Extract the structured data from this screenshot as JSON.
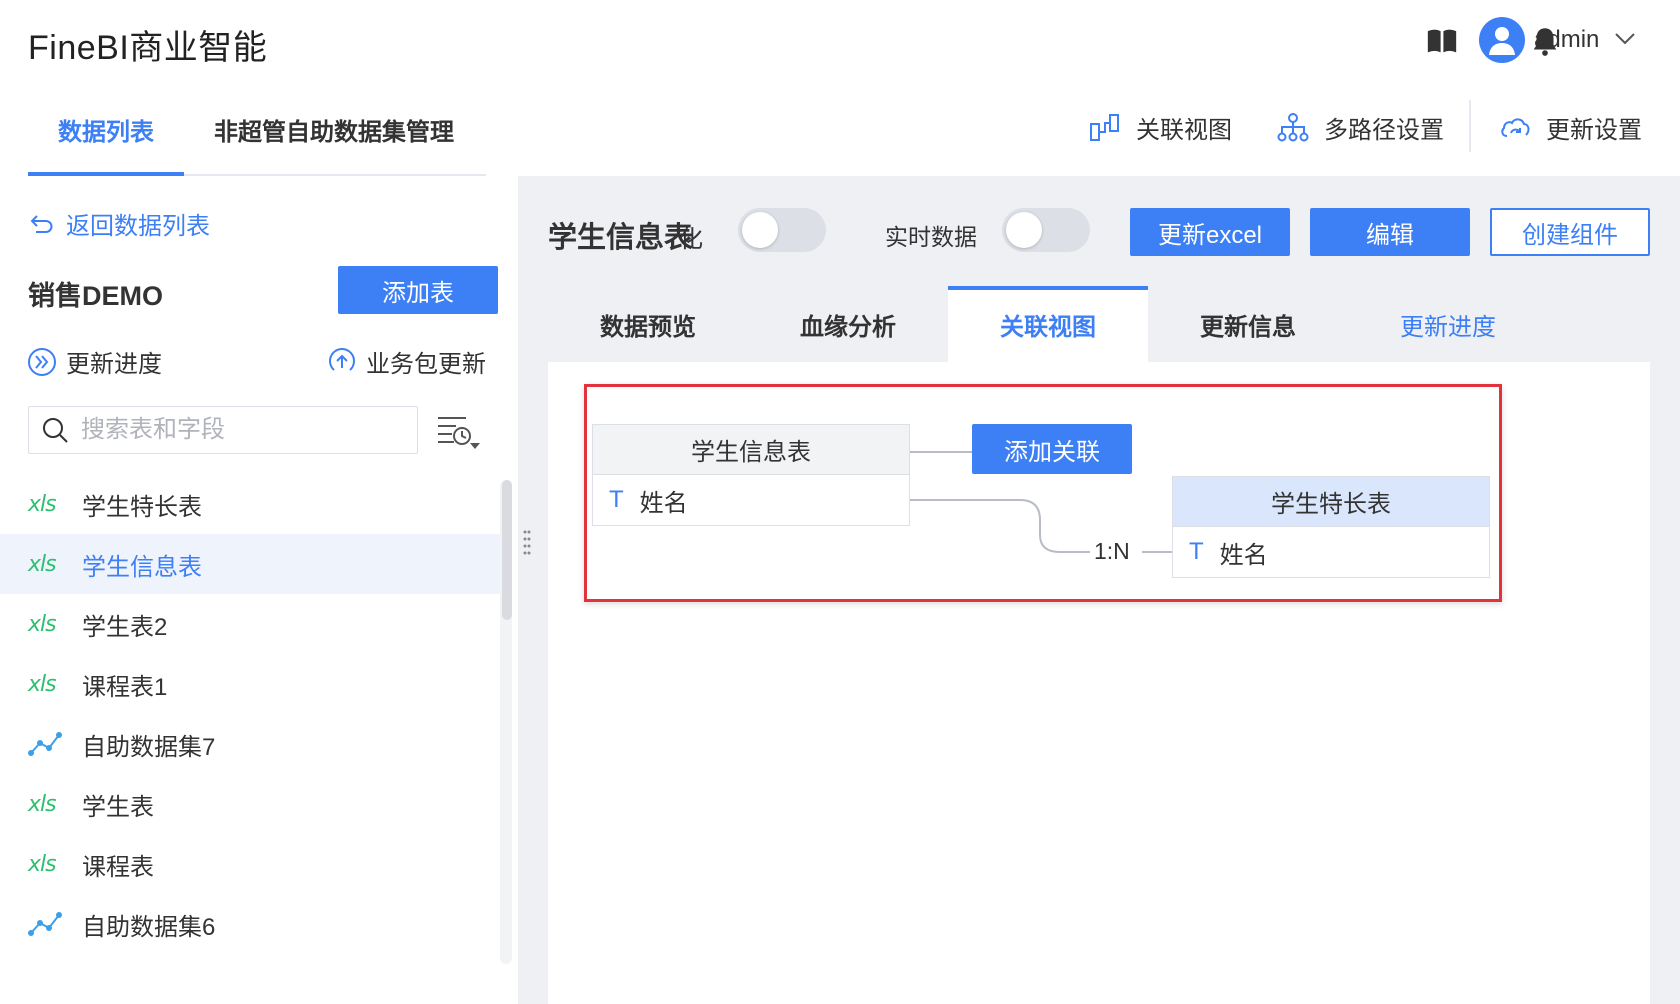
{
  "app": {
    "title": "FineBI商业智能"
  },
  "header": {
    "icons": [
      "book-icon",
      "bell-icon",
      "user-avatar-icon",
      "chevron-down-icon"
    ],
    "username": "admin"
  },
  "tabs": [
    {
      "label": "数据列表",
      "active": true
    },
    {
      "label": "非超管自助数据集管理",
      "active": false
    }
  ],
  "toolbar": {
    "relation_view": "关联视图",
    "multipath": "多路径设置",
    "update_settings": "更新设置"
  },
  "sidebar": {
    "back_link": "返回数据列表",
    "package_name": "销售DEMO",
    "add_table_button": "添加表",
    "update_progress": "更新进度",
    "package_update": "业务包更新",
    "search_placeholder": "搜索表和字段",
    "items": [
      {
        "label": "学生特长表",
        "icon": "xls"
      },
      {
        "label": "学生信息表",
        "icon": "xls",
        "selected": true
      },
      {
        "label": "学生表2",
        "icon": "xls"
      },
      {
        "label": "课程表1",
        "icon": "xls"
      },
      {
        "label": "自助数据集7",
        "icon": "dataset"
      },
      {
        "label": "学生表",
        "icon": "xls"
      },
      {
        "label": "课程表",
        "icon": "xls"
      },
      {
        "label": "自助数据集6",
        "icon": "dataset"
      }
    ],
    "xls_label": "xls"
  },
  "detail": {
    "table_title": "学生信息表",
    "title_overlap": "化",
    "realtime_label": "实时数据",
    "buttons": {
      "update_excel": "更新excel",
      "edit": "编辑",
      "create_component": "创建组件"
    },
    "subtabs": [
      {
        "label": "数据预览"
      },
      {
        "label": "血缘分析"
      },
      {
        "label": "关联视图",
        "active": true
      },
      {
        "label": "更新信息"
      },
      {
        "label": "更新进度",
        "link": true
      }
    ]
  },
  "relation": {
    "left_table": {
      "name": "学生信息表",
      "field": "姓名",
      "field_type": "T"
    },
    "right_table": {
      "name": "学生特长表",
      "field": "姓名",
      "field_type": "T"
    },
    "add_relation_button": "添加关联",
    "cardinality": "1:N"
  },
  "colors": {
    "accent": "#3d7ff5",
    "xls_green": "#2fbf71",
    "highlight_red": "#e2333c",
    "panel_bg": "#eef0f4"
  }
}
